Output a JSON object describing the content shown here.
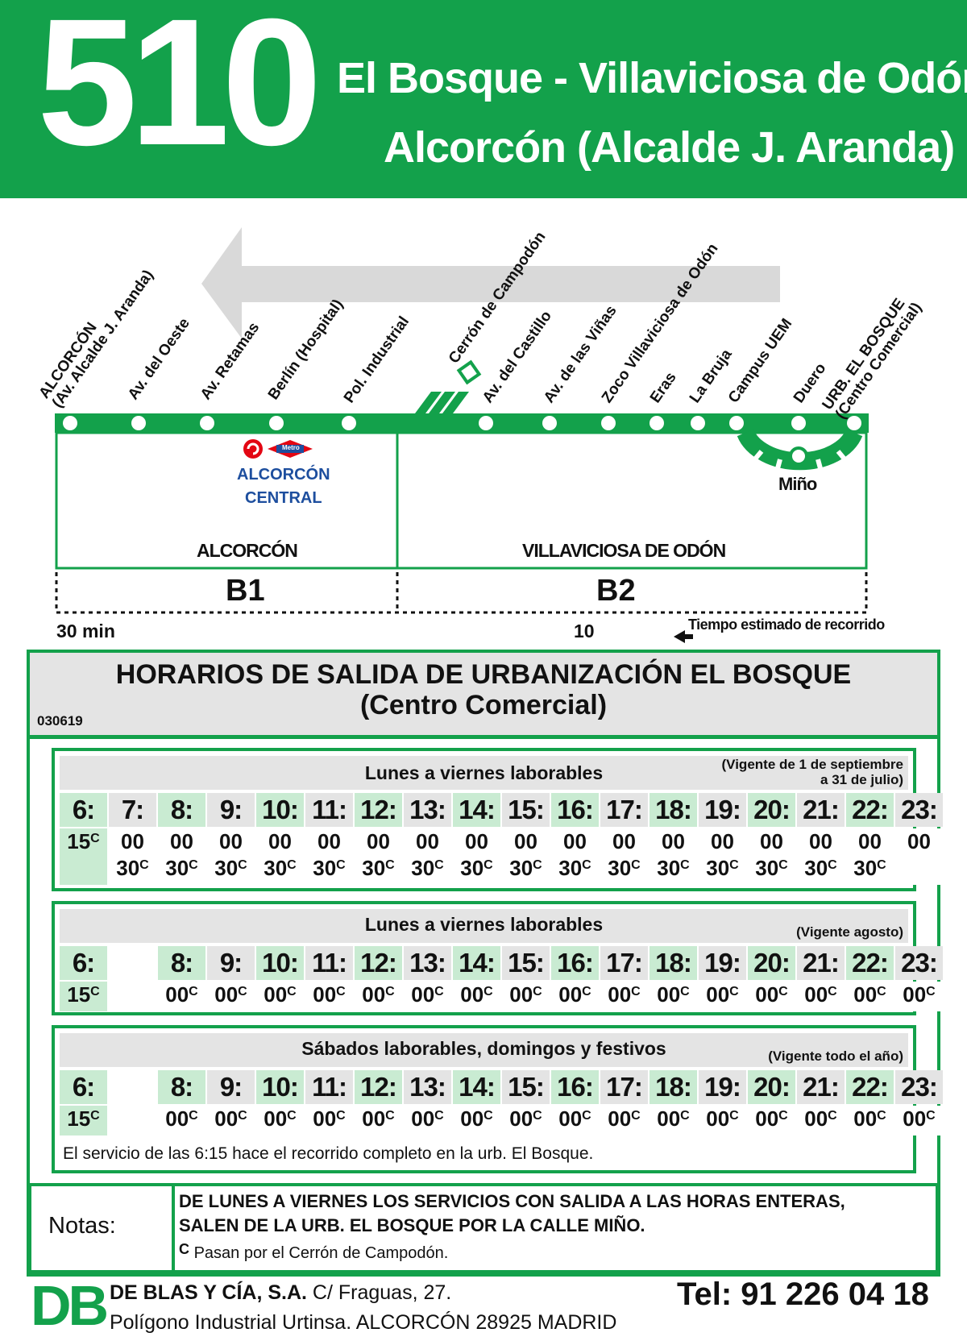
{
  "header": {
    "route_number": "510",
    "route_line1": "El Bosque - Villaviciosa de Odón -",
    "route_line2": "Alcorcón (Alcalde J. Aranda)"
  },
  "diagram": {
    "stops": [
      {
        "l1": "ALCORCÓN",
        "l2": "(Av. Alcalde J. Aranda)"
      },
      {
        "l1": "Av. del Oeste",
        "l2": ""
      },
      {
        "l1": "Av. Retamas",
        "l2": ""
      },
      {
        "l1": "Berlín (Hospital)",
        "l2": ""
      },
      {
        "l1": "Pol. Industrial",
        "l2": ""
      },
      {
        "l1": "Cerrón de Campodón",
        "l2": ""
      },
      {
        "l1": "Av. del Castillo",
        "l2": ""
      },
      {
        "l1": "Av. de las Viñas",
        "l2": ""
      },
      {
        "l1": "Zoco Villaviciosa de Odón",
        "l2": ""
      },
      {
        "l1": "Eras",
        "l2": ""
      },
      {
        "l1": "La Bruja",
        "l2": ""
      },
      {
        "l1": "Campus UEM",
        "l2": ""
      },
      {
        "l1": "Duero",
        "l2": ""
      },
      {
        "l1": "URB. EL BOSQUE",
        "l2": "(Centro Comercial)"
      }
    ],
    "metro_badge": "Metro",
    "station_line1": "ALCORCÓN",
    "station_line2": "CENTRAL",
    "loop_label": "Miño",
    "zone_left": "ALCORCÓN",
    "zone_right": "VILLAVICIOSA DE ODÓN",
    "fare_left": "B1",
    "fare_right": "B2",
    "time_left": "30 min",
    "time_right": "10",
    "time_note": "Tiempo estimado de recorrido"
  },
  "schedule": {
    "title_line1": "HORARIOS DE SALIDA DE URBANIZACIÓN EL BOSQUE",
    "title_line2": "(Centro Comercial)",
    "code": "030619",
    "footnote": "El servicio de las 6:15 hace el recorrido completo en la urb. El Bosque.",
    "tables": [
      {
        "title": "Lunes a viernes laborables",
        "validity_line1": "(Vigente de 1 de septiembre",
        "validity_line2": "a 31 de julio)",
        "hours": [
          "6:",
          "7:",
          "8:",
          "9:",
          "10:",
          "11:",
          "12:",
          "13:",
          "14:",
          "15:",
          "16:",
          "17:",
          "18:",
          "19:",
          "20:",
          "21:",
          "22:",
          "23:"
        ],
        "line1": [
          "15",
          "00",
          "00",
          "00",
          "00",
          "00",
          "00",
          "00",
          "00",
          "00",
          "00",
          "00",
          "00",
          "00",
          "00",
          "00",
          "00",
          "00"
        ],
        "line1_sup": [
          "C",
          "",
          "",
          "",
          "",
          "",
          "",
          "",
          "",
          "",
          "",
          "",
          "",
          "",
          "",
          "",
          "",
          ""
        ],
        "line2": [
          "",
          "30",
          "30",
          "30",
          "30",
          "30",
          "30",
          "30",
          "30",
          "30",
          "30",
          "30",
          "30",
          "30",
          "30",
          "30",
          "30",
          ""
        ],
        "line2_sup": [
          "",
          "C",
          "C",
          "C",
          "C",
          "C",
          "C",
          "C",
          "C",
          "C",
          "C",
          "C",
          "C",
          "C",
          "C",
          "C",
          "C",
          ""
        ]
      },
      {
        "title": "Lunes a viernes laborables",
        "validity_line1": "",
        "validity_line2": "(Vigente agosto)",
        "hours": [
          "6:",
          "",
          "8:",
          "9:",
          "10:",
          "11:",
          "12:",
          "13:",
          "14:",
          "15:",
          "16:",
          "17:",
          "18:",
          "19:",
          "20:",
          "21:",
          "22:",
          "23:"
        ],
        "line1": [
          "15",
          "",
          "00",
          "00",
          "00",
          "00",
          "00",
          "00",
          "00",
          "00",
          "00",
          "00",
          "00",
          "00",
          "00",
          "00",
          "00",
          "00"
        ],
        "line1_sup": [
          "C",
          "",
          "C",
          "C",
          "C",
          "C",
          "C",
          "C",
          "C",
          "C",
          "C",
          "C",
          "C",
          "C",
          "C",
          "C",
          "C",
          "C"
        ]
      },
      {
        "title": "Sábados laborables, domingos y festivos",
        "validity_line1": "",
        "validity_line2": "(Vigente todo el año)",
        "hours": [
          "6:",
          "",
          "8:",
          "9:",
          "10:",
          "11:",
          "12:",
          "13:",
          "14:",
          "15:",
          "16:",
          "17:",
          "18:",
          "19:",
          "20:",
          "21:",
          "22:",
          "23:"
        ],
        "line1": [
          "15",
          "",
          "00",
          "00",
          "00",
          "00",
          "00",
          "00",
          "00",
          "00",
          "00",
          "00",
          "00",
          "00",
          "00",
          "00",
          "00",
          "00"
        ],
        "line1_sup": [
          "C",
          "",
          "C",
          "C",
          "C",
          "C",
          "C",
          "C",
          "C",
          "C",
          "C",
          "C",
          "C",
          "C",
          "C",
          "C",
          "C",
          "C"
        ]
      }
    ]
  },
  "notes": {
    "label": "Notas:",
    "line1": "DE LUNES A VIERNES LOS SERVICIOS CON SALIDA A LAS HORAS ENTERAS,",
    "line2": "SALEN DE LA URB. EL BOSQUE POR LA CALLE MIÑO.",
    "footnote_mark": "C",
    "footnote_text": "Pasan por el Cerrón de Campodón."
  },
  "footer": {
    "logo": "DB",
    "company_name": "DE BLAS Y CÍA, S.A.",
    "company_street": "C/ Fraguas, 27.",
    "address": "Polígono Industrial Urtinsa. ALCORCÓN 28925 MADRID",
    "phone": "Tel: 91 226 04 18"
  },
  "colors": {
    "brand_green": "#13a14b",
    "light_green": "#c9ebd2",
    "grey": "#e4e4e4",
    "metro_red": "#e30613",
    "metro_blue": "#1d4e9e"
  }
}
